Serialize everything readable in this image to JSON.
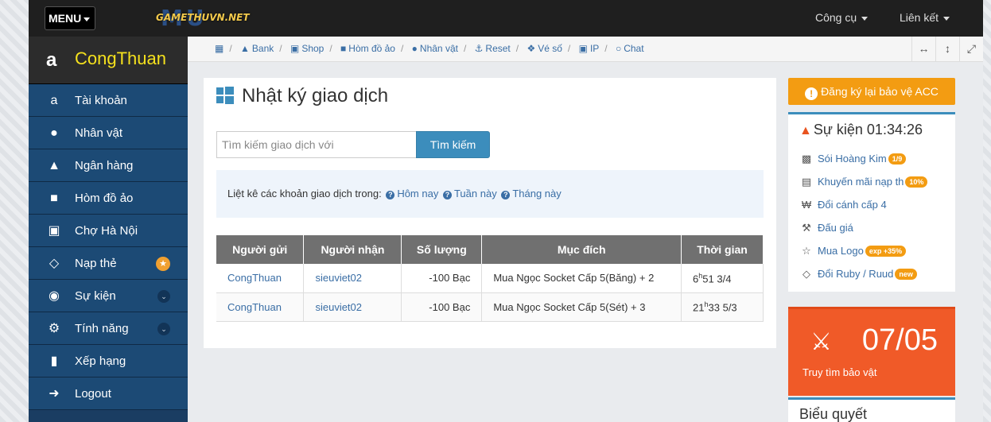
{
  "topbar": {
    "menu_label": "MENU",
    "logo_text": "GAMETHUVN.NET",
    "logo_mark": "MU",
    "tools_label": "Công cụ",
    "links_label": "Liên kết"
  },
  "sidebar": {
    "user_name": "CongThuan",
    "items": [
      {
        "label": "Tài khoản",
        "icon": "amazon-icon"
      },
      {
        "label": "Nhân vật",
        "icon": "user-icon"
      },
      {
        "label": "Ngân hàng",
        "icon": "bank-icon"
      },
      {
        "label": "Hòm đồ ảo",
        "icon": "briefcase-icon"
      },
      {
        "label": "Chợ Hà Nội",
        "icon": "cart-icon"
      },
      {
        "label": "Nạp thẻ",
        "icon": "diamond-icon"
      },
      {
        "label": "Sự kiện",
        "icon": "android-icon"
      },
      {
        "label": "Tính năng",
        "icon": "gears-icon"
      },
      {
        "label": "Xếp hạng",
        "icon": "bar-chart-icon"
      },
      {
        "label": "Logout",
        "icon": "sign-out-icon"
      }
    ]
  },
  "breadcrumb": {
    "items": [
      "Bank",
      "Shop",
      "Hòm đồ ảo",
      "Nhân vật",
      "Reset",
      "Vé số",
      "IP",
      "Chat"
    ]
  },
  "main": {
    "title": "Nhật ký giao dịch",
    "search_placeholder": "Tìm kiếm giao dịch với",
    "search_button": "Tìm kiếm",
    "filter_prefix": "Liệt kê các khoản giao dịch trong:",
    "filter_today": "Hôm nay",
    "filter_week": "Tuần này",
    "filter_month": "Tháng này",
    "table": {
      "headers": [
        "Người gửi",
        "Người nhận",
        "Số lượng",
        "Mục đích",
        "Thời gian"
      ],
      "rows": [
        {
          "sender": "CongThuan",
          "receiver": "sieuviet02",
          "amount": "-100  Bạc",
          "purpose": "Mua Ngọc Socket Cấp 5(Băng) + 2",
          "hour": "6",
          "minute": "51 3/4",
          "hmark": "h"
        },
        {
          "sender": "CongThuan",
          "receiver": "sieuviet02",
          "amount": "-100  Bạc",
          "purpose": "Mua Ngọc Socket Cấp 5(Sét) + 3",
          "hour": "21",
          "minute": "33 5/3",
          "hmark": "h"
        }
      ]
    }
  },
  "right": {
    "protect_button": "Đăng ký lại bảo vệ ACC",
    "events_title": "Sự kiện 01:34:26",
    "events": [
      {
        "label": "Sói Hoàng Kim",
        "badge": "1/9"
      },
      {
        "label": "Khuyến mãi nạp th",
        "badge": "10%"
      },
      {
        "label": "Đổi cánh cấp 4",
        "badge": ""
      },
      {
        "label": "Đấu giá",
        "badge": ""
      },
      {
        "label": "Mua Logo",
        "badge": "exp +35%"
      },
      {
        "label": "Đổi Ruby / Ruud",
        "badge": "new"
      }
    ],
    "treasure_date": "07/05",
    "treasure_label": "Truy tìm bảo vật",
    "vote_title": "Biểu quyết"
  }
}
